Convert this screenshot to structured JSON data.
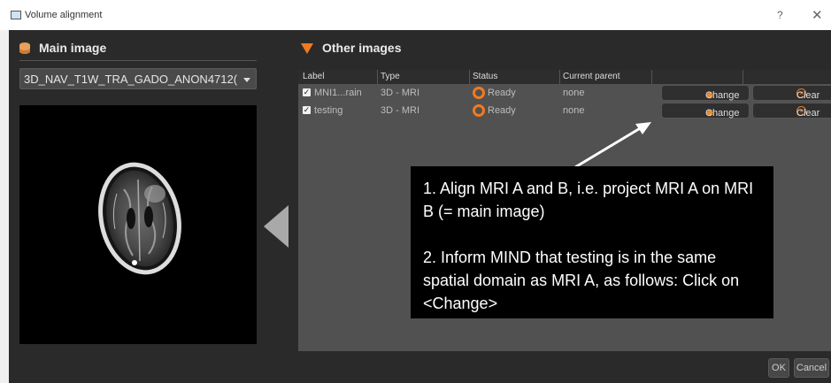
{
  "window": {
    "title": "Volume alignment",
    "help": "?",
    "close": "✕"
  },
  "main_panel": {
    "header": "Main image",
    "selected_image": "3D_NAV_T1W_TRA_GADO_ANON4712("
  },
  "other_panel": {
    "header": "Other images",
    "columns": [
      "Label",
      "Type",
      "Status",
      "Current parent"
    ],
    "rows": [
      {
        "checked": true,
        "label": "MNI1...rain",
        "type": "3D - MRI",
        "status": "Ready",
        "parent": "none",
        "change": "Change",
        "clear": "Clear"
      },
      {
        "checked": true,
        "label": "testing",
        "type": "3D - MRI",
        "status": "Ready",
        "parent": "none",
        "change": "Change",
        "clear": "Clear"
      }
    ]
  },
  "annotation": {
    "step1": "1. Align MRI A and B, i.e. project MRI A on MRI B (= main image)",
    "step2": "2. Inform MIND that testing is in the same spatial domain as MRI A, as follows: Click on <Change>"
  },
  "footer": {
    "ok": "OK",
    "cancel": "Cancel"
  },
  "colors": {
    "accent": "#f07a21",
    "background": "#2a2a2a",
    "table": "#515151"
  }
}
